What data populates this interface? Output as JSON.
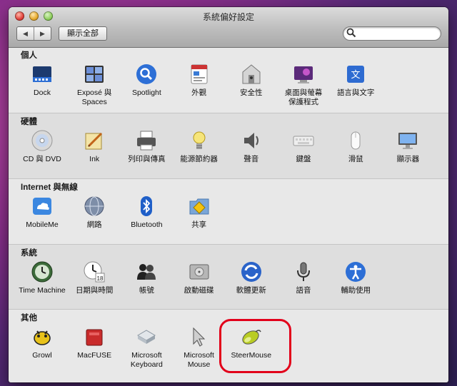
{
  "window": {
    "title": "系統偏好設定"
  },
  "toolbar": {
    "back": "◀",
    "forward": "▶",
    "show_all": "顯示全部",
    "search_value": ""
  },
  "sections": [
    {
      "title": "個人",
      "items": [
        {
          "label": "Dock",
          "icon": "dock-icon"
        },
        {
          "label": "Exposé 與\nSpaces",
          "icon": "expose-spaces-icon"
        },
        {
          "label": "Spotlight",
          "icon": "spotlight-icon"
        },
        {
          "label": "外觀",
          "icon": "appearance-icon"
        },
        {
          "label": "安全性",
          "icon": "security-icon"
        },
        {
          "label": "桌面與螢幕\n保護程式",
          "icon": "desktop-screensaver-icon"
        },
        {
          "label": "語言與文字",
          "icon": "language-text-icon"
        }
      ]
    },
    {
      "title": "硬體",
      "items": [
        {
          "label": "CD 與 DVD",
          "icon": "cd-dvd-icon"
        },
        {
          "label": "Ink",
          "icon": "ink-icon"
        },
        {
          "label": "列印與傳真",
          "icon": "print-fax-icon"
        },
        {
          "label": "能源節約器",
          "icon": "energy-saver-icon"
        },
        {
          "label": "聲音",
          "icon": "sound-icon"
        },
        {
          "label": "鍵盤",
          "icon": "keyboard-icon"
        },
        {
          "label": "滑鼠",
          "icon": "mouse-icon"
        },
        {
          "label": "顯示器",
          "icon": "display-icon"
        }
      ]
    },
    {
      "title": "Internet 與無線",
      "items": [
        {
          "label": "MobileMe",
          "icon": "mobileme-icon"
        },
        {
          "label": "網路",
          "icon": "network-icon"
        },
        {
          "label": "Bluetooth",
          "icon": "bluetooth-icon"
        },
        {
          "label": "共享",
          "icon": "sharing-icon"
        }
      ]
    },
    {
      "title": "系統",
      "items": [
        {
          "label": "Time Machine",
          "icon": "time-machine-icon"
        },
        {
          "label": "日期與時間",
          "icon": "date-time-icon"
        },
        {
          "label": "帳號",
          "icon": "accounts-icon"
        },
        {
          "label": "啟動磁碟",
          "icon": "startup-disk-icon"
        },
        {
          "label": "軟體更新",
          "icon": "software-update-icon"
        },
        {
          "label": "語音",
          "icon": "speech-icon"
        },
        {
          "label": "輔助使用",
          "icon": "universal-access-icon"
        }
      ]
    },
    {
      "title": "其他",
      "items": [
        {
          "label": "Growl",
          "icon": "growl-icon"
        },
        {
          "label": "MacFUSE",
          "icon": "macfuse-icon"
        },
        {
          "label": "Microsoft\nKeyboard",
          "icon": "microsoft-keyboard-icon"
        },
        {
          "label": "Microsoft\nMouse",
          "icon": "microsoft-mouse-icon"
        },
        {
          "label": "SteerMouse",
          "icon": "steermouse-icon"
        }
      ]
    }
  ],
  "colors": {
    "highlight_ring": "#e2001a",
    "section_alt_bg": "#dedede",
    "pane_bg": "#e8e8e8"
  }
}
